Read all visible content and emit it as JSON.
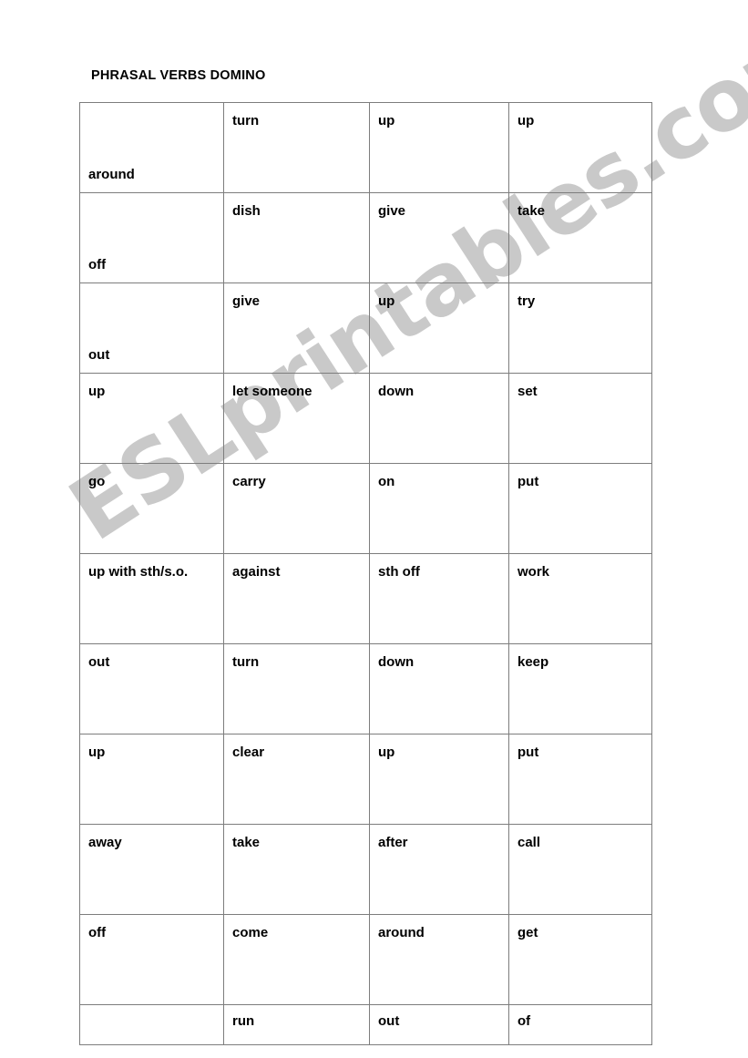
{
  "document": {
    "title": "PHRASAL VERBS DOMINO",
    "watermark": "ESLprintables.com",
    "watermark_color": "#c9c9c9",
    "border_color": "#7d7d7d",
    "text_color": "#000000",
    "background_color": "#ffffff"
  },
  "table": {
    "columns": 4,
    "rows": [
      {
        "align": "mixed",
        "height": "tall",
        "cells": [
          "around",
          "turn",
          "up",
          "up"
        ]
      },
      {
        "align": "mixed",
        "height": "tall",
        "cells": [
          "off",
          "dish",
          "give",
          "take"
        ]
      },
      {
        "align": "mixed",
        "height": "tall",
        "cells": [
          "out",
          "give",
          "up",
          "try"
        ]
      },
      {
        "align": "top",
        "height": "tall",
        "cells": [
          "up",
          "let someone",
          "down",
          "set"
        ]
      },
      {
        "align": "top",
        "height": "tall",
        "cells": [
          "go",
          "carry",
          "on",
          "put"
        ]
      },
      {
        "align": "top",
        "height": "tall",
        "cells": [
          "up with sth/s.o.",
          "against",
          "sth off",
          "work"
        ]
      },
      {
        "align": "top",
        "height": "tall",
        "cells": [
          "out",
          "turn",
          "down",
          "keep"
        ]
      },
      {
        "align": "top",
        "height": "tall",
        "cells": [
          "up",
          "clear",
          "up",
          "put"
        ]
      },
      {
        "align": "top",
        "height": "tall",
        "cells": [
          "away",
          "take",
          "after",
          "call"
        ]
      },
      {
        "align": "top",
        "height": "tall",
        "cells": [
          "off",
          "come",
          "around",
          "get"
        ]
      },
      {
        "align": "top",
        "height": "short",
        "cells": [
          "",
          "run",
          "out",
          "of"
        ]
      }
    ]
  }
}
